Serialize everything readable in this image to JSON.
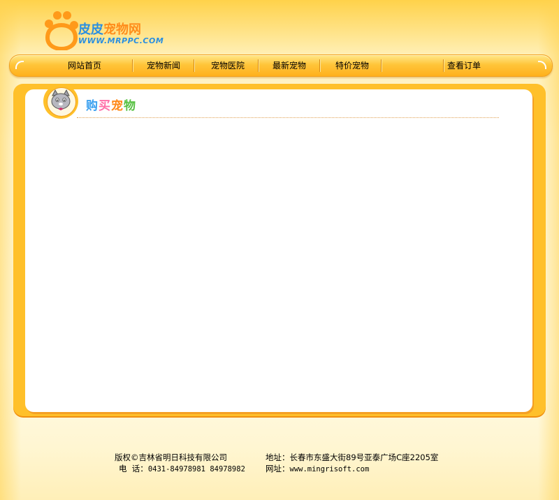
{
  "logo": {
    "text_part1": "皮皮",
    "text_part2": "宠物网",
    "url": "WWW.MRPPC.COM"
  },
  "nav": {
    "items": [
      "网站首页",
      "宠物新闻",
      "宠物医院",
      "最新宠物",
      "特价宠物",
      "",
      "查看订单"
    ]
  },
  "section": {
    "title_chars": [
      "购",
      "买",
      "宠",
      "物"
    ]
  },
  "footer": {
    "copyright": "版权©吉林省明日科技有限公司",
    "phone_label": "电  话：",
    "phone_value": "0431-84978981 84978982",
    "address": "地址：长春市东盛大街89号亚泰广场C座2205室",
    "website_label": "网址：",
    "website_value": "www.mingrisoft.com"
  },
  "colors": {
    "nav": "#ffc53a",
    "panel_border": "#ffc02a",
    "logo_blue": "#2a8fe0",
    "logo_orange": "#ff8c1a"
  }
}
